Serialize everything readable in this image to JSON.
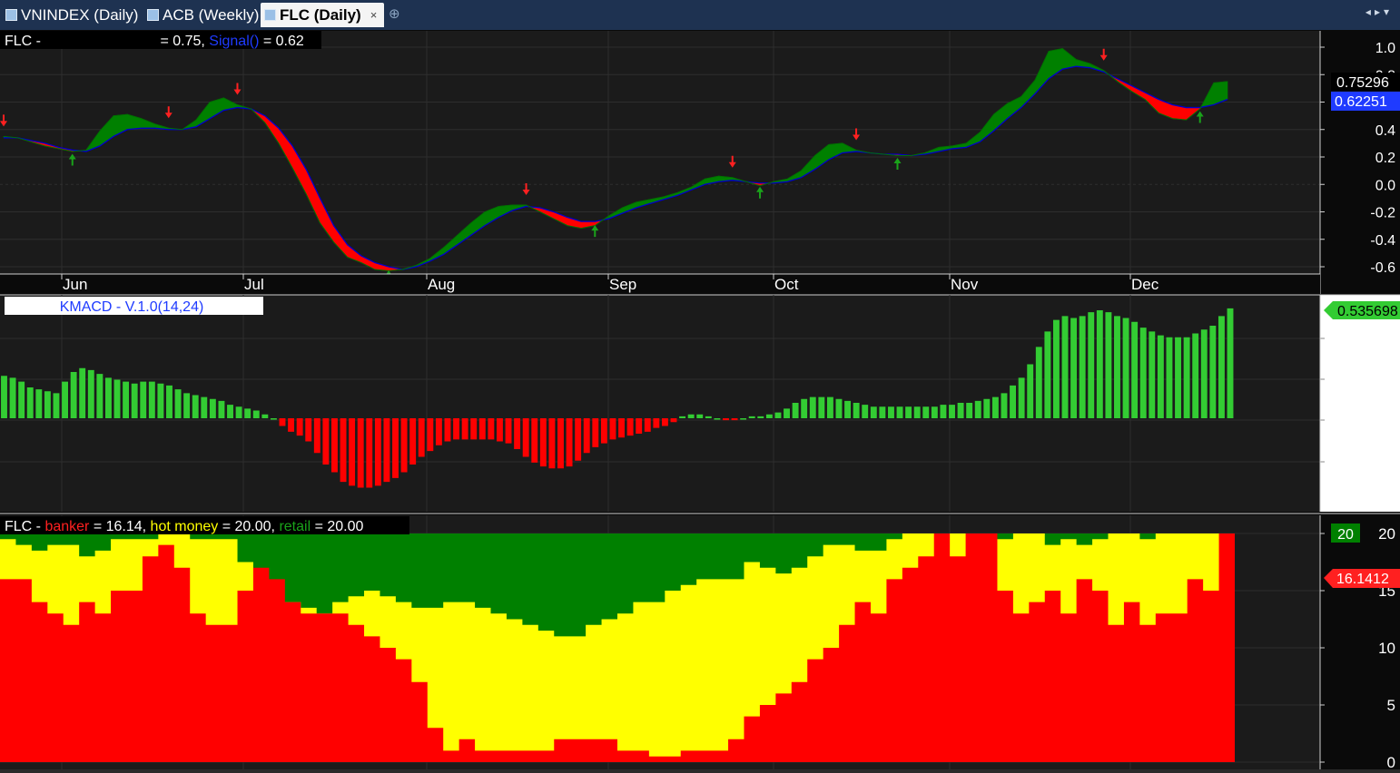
{
  "tabs": [
    {
      "label": "VNINDEX (Daily)",
      "active": false
    },
    {
      "label": "ACB (Weekly)",
      "active": false
    },
    {
      "label": "FLC (Daily)",
      "active": true
    }
  ],
  "tab_close_glyph": "×",
  "colors": {
    "bg": "#0a0a0a",
    "grid": "#2e2e2e",
    "green": "#008000",
    "red": "#ff0000",
    "yellow": "#ffff00",
    "hist_green": "#33cc33",
    "blue": "#0000cc",
    "axis_bg": "#ffffff",
    "tabbar": "#1e3251"
  },
  "panel1": {
    "title_symbol": "FLC -",
    "title_main": " = 0.75, ",
    "title_signal_name": "Signal()",
    "title_signal_value": " = 0.62",
    "price_tag_main": "0.75296",
    "price_tag_signal": "0.62251"
  },
  "panel2": {
    "title": "KMACD - V.1.0(14,24)",
    "value_tag": "0.535698"
  },
  "panel3": {
    "title_symbol": "FLC - ",
    "banker_label": "banker",
    "banker_value": " = 16.14, ",
    "hot_label": "hot money",
    "hot_value": " = 20.00, ",
    "retail_label": "retail",
    "retail_value": " = 20.00",
    "tag_top": "20",
    "tag_banker": "16.1412"
  },
  "chart_data": [
    {
      "type": "area",
      "title": "FLC",
      "series": [
        {
          "name": "",
          "values": [
            0.35,
            0.34,
            0.31,
            0.28,
            0.26,
            0.24,
            0.25,
            0.39,
            0.5,
            0.51,
            0.48,
            0.44,
            0.41,
            0.4,
            0.47,
            0.6,
            0.63,
            0.58,
            0.55,
            0.45,
            0.3,
            0.12,
            -0.07,
            -0.28,
            -0.42,
            -0.53,
            -0.57,
            -0.62,
            -0.63,
            -0.62,
            -0.59,
            -0.54,
            -0.46,
            -0.37,
            -0.28,
            -0.2,
            -0.16,
            -0.15,
            -0.15,
            -0.2,
            -0.25,
            -0.3,
            -0.32,
            -0.3,
            -0.23,
            -0.17,
            -0.13,
            -0.11,
            -0.09,
            -0.06,
            -0.02,
            0.04,
            0.06,
            0.05,
            0.02,
            -0.01,
            0.02,
            0.04,
            0.1,
            0.21,
            0.29,
            0.3,
            0.25,
            0.23,
            0.22,
            0.21,
            0.21,
            0.23,
            0.27,
            0.28,
            0.3,
            0.38,
            0.51,
            0.59,
            0.64,
            0.76,
            0.97,
            0.99,
            0.91,
            0.88,
            0.83,
            0.75,
            0.68,
            0.62,
            0.52,
            0.48,
            0.47,
            0.55,
            0.74,
            0.75
          ]
        },
        {
          "name": "Signal()",
          "values": [
            0.34,
            0.34,
            0.32,
            0.3,
            0.27,
            0.25,
            0.24,
            0.28,
            0.35,
            0.4,
            0.41,
            0.41,
            0.4,
            0.4,
            0.42,
            0.48,
            0.54,
            0.56,
            0.55,
            0.5,
            0.41,
            0.28,
            0.11,
            -0.1,
            -0.3,
            -0.44,
            -0.52,
            -0.57,
            -0.6,
            -0.62,
            -0.6,
            -0.56,
            -0.51,
            -0.44,
            -0.37,
            -0.3,
            -0.24,
            -0.19,
            -0.16,
            -0.17,
            -0.2,
            -0.24,
            -0.27,
            -0.27,
            -0.25,
            -0.21,
            -0.17,
            -0.14,
            -0.11,
            -0.08,
            -0.04,
            0.0,
            0.02,
            0.03,
            0.02,
            0.01,
            0.01,
            0.02,
            0.05,
            0.11,
            0.18,
            0.23,
            0.24,
            0.23,
            0.22,
            0.22,
            0.21,
            0.22,
            0.24,
            0.26,
            0.27,
            0.31,
            0.39,
            0.48,
            0.56,
            0.66,
            0.77,
            0.84,
            0.86,
            0.85,
            0.82,
            0.77,
            0.72,
            0.67,
            0.62,
            0.58,
            0.56,
            0.56,
            0.58,
            0.62
          ]
        }
      ],
      "x_labels": [
        "Jun",
        "Jul",
        "Aug",
        "Sep",
        "Oct",
        "Nov",
        "Dec"
      ],
      "y_ticks": [
        "1.0",
        "0.8",
        "0.6",
        "0.4",
        "0.2",
        "0.0",
        "-0.2",
        "-0.4",
        "-0.6"
      ],
      "ylim": [
        -0.65,
        1.05
      ],
      "grid": true
    },
    {
      "type": "bar",
      "title": "KMACD - V.1.0(14,24)",
      "values": [
        0.22,
        0.21,
        0.19,
        0.16,
        0.15,
        0.14,
        0.13,
        0.19,
        0.24,
        0.26,
        0.25,
        0.23,
        0.21,
        0.2,
        0.19,
        0.18,
        0.19,
        0.19,
        0.18,
        0.17,
        0.15,
        0.13,
        0.12,
        0.11,
        0.1,
        0.09,
        0.07,
        0.06,
        0.05,
        0.04,
        0.02,
        0.0,
        -0.04,
        -0.07,
        -0.09,
        -0.12,
        -0.18,
        -0.24,
        -0.28,
        -0.33,
        -0.35,
        -0.36,
        -0.36,
        -0.35,
        -0.33,
        -0.31,
        -0.28,
        -0.24,
        -0.2,
        -0.17,
        -0.14,
        -0.12,
        -0.11,
        -0.11,
        -0.11,
        -0.11,
        -0.11,
        -0.12,
        -0.13,
        -0.16,
        -0.2,
        -0.23,
        -0.25,
        -0.26,
        -0.26,
        -0.25,
        -0.22,
        -0.18,
        -0.15,
        -0.13,
        -0.11,
        -0.1,
        -0.09,
        -0.08,
        -0.07,
        -0.05,
        -0.04,
        -0.02,
        0.01,
        0.02,
        0.02,
        0.01,
        0.0,
        -0.01,
        -0.01,
        0.0,
        0.01,
        0.01,
        0.02,
        0.03,
        0.05,
        0.08,
        0.1,
        0.11,
        0.11,
        0.11,
        0.1,
        0.09,
        0.08,
        0.07,
        0.06,
        0.06,
        0.06,
        0.06,
        0.06,
        0.06,
        0.06,
        0.06,
        0.07,
        0.07,
        0.08,
        0.08,
        0.09,
        0.1,
        0.11,
        0.13,
        0.17,
        0.21,
        0.28,
        0.37,
        0.45,
        0.51,
        0.53,
        0.52,
        0.53,
        0.55,
        0.56,
        0.55,
        0.53,
        0.52,
        0.5,
        0.47,
        0.45,
        0.43,
        0.42,
        0.42,
        0.42,
        0.44,
        0.46,
        0.48,
        0.53,
        0.57
      ],
      "value_label": "0.535698",
      "grid": true
    },
    {
      "type": "area",
      "title": "FLC",
      "series": [
        {
          "name": "banker",
          "values": [
            16,
            16,
            14,
            13,
            12,
            14,
            13,
            15,
            15,
            18,
            19,
            17,
            13,
            12,
            12,
            15,
            17,
            16,
            14,
            13,
            13,
            13,
            12,
            11,
            10,
            9,
            7,
            3,
            1,
            2,
            1,
            1,
            1,
            1,
            1,
            2,
            2,
            2,
            2,
            1,
            1,
            0.5,
            0.5,
            1,
            1,
            1,
            2,
            4,
            5,
            6,
            7,
            9,
            10,
            12,
            14,
            13,
            16,
            17,
            18,
            20,
            18,
            20,
            20,
            15,
            13,
            14,
            15,
            13,
            16,
            15,
            12,
            14,
            12,
            13,
            13,
            16,
            15,
            20
          ]
        },
        {
          "name": "hot money",
          "values": [
            19.5,
            19,
            18.5,
            19,
            19,
            18,
            18.5,
            19.5,
            19.5,
            19.5,
            20,
            20,
            19.5,
            19.5,
            19.5,
            17.5,
            15,
            14,
            14,
            13.5,
            13,
            14,
            14.5,
            15,
            14.5,
            14,
            13.5,
            13.5,
            14,
            14,
            13.5,
            13,
            12.5,
            12,
            11.5,
            11,
            11,
            12,
            12.5,
            13,
            14,
            14,
            15,
            15.5,
            16,
            16,
            16,
            17.5,
            17,
            16.5,
            17,
            18,
            19,
            19,
            18.5,
            18.5,
            19.5,
            20,
            20,
            20,
            20,
            20,
            19.5,
            19.5,
            20,
            20,
            19,
            19.5,
            19,
            19.5,
            20,
            20,
            19.5,
            20,
            20,
            20,
            20,
            20
          ]
        },
        {
          "name": "retail",
          "values": [
            20,
            20,
            20,
            20,
            20,
            20,
            20,
            20,
            20,
            20,
            20,
            20,
            20,
            20,
            20,
            20,
            20,
            20,
            20,
            20,
            20,
            20,
            20,
            20,
            20,
            20,
            20,
            20,
            20,
            20,
            20,
            20,
            20,
            20,
            20,
            20,
            20,
            20,
            20,
            20,
            20,
            20,
            20,
            20,
            20,
            20,
            20,
            20,
            20,
            20,
            20,
            20,
            20,
            20,
            20,
            20,
            20,
            20,
            20,
            20,
            20,
            20,
            20,
            20,
            20,
            20,
            20,
            20,
            20,
            20,
            20,
            20,
            20,
            20,
            20,
            20,
            20,
            20
          ]
        }
      ],
      "y_ticks": [
        "20",
        "15",
        "10",
        "5",
        "0"
      ],
      "ylim": [
        0,
        20
      ],
      "grid": true
    }
  ]
}
